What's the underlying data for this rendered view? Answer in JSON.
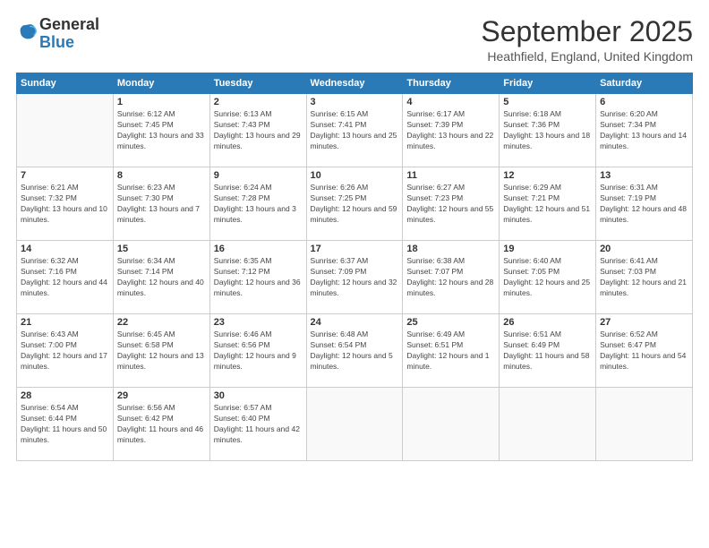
{
  "logo": {
    "text_general": "General",
    "text_blue": "Blue"
  },
  "title": "September 2025",
  "location": "Heathfield, England, United Kingdom",
  "days_of_week": [
    "Sunday",
    "Monday",
    "Tuesday",
    "Wednesday",
    "Thursday",
    "Friday",
    "Saturday"
  ],
  "weeks": [
    [
      {
        "day": "",
        "sunrise": "",
        "sunset": "",
        "daylight": ""
      },
      {
        "day": "1",
        "sunrise": "Sunrise: 6:12 AM",
        "sunset": "Sunset: 7:45 PM",
        "daylight": "Daylight: 13 hours and 33 minutes."
      },
      {
        "day": "2",
        "sunrise": "Sunrise: 6:13 AM",
        "sunset": "Sunset: 7:43 PM",
        "daylight": "Daylight: 13 hours and 29 minutes."
      },
      {
        "day": "3",
        "sunrise": "Sunrise: 6:15 AM",
        "sunset": "Sunset: 7:41 PM",
        "daylight": "Daylight: 13 hours and 25 minutes."
      },
      {
        "day": "4",
        "sunrise": "Sunrise: 6:17 AM",
        "sunset": "Sunset: 7:39 PM",
        "daylight": "Daylight: 13 hours and 22 minutes."
      },
      {
        "day": "5",
        "sunrise": "Sunrise: 6:18 AM",
        "sunset": "Sunset: 7:36 PM",
        "daylight": "Daylight: 13 hours and 18 minutes."
      },
      {
        "day": "6",
        "sunrise": "Sunrise: 6:20 AM",
        "sunset": "Sunset: 7:34 PM",
        "daylight": "Daylight: 13 hours and 14 minutes."
      }
    ],
    [
      {
        "day": "7",
        "sunrise": "Sunrise: 6:21 AM",
        "sunset": "Sunset: 7:32 PM",
        "daylight": "Daylight: 13 hours and 10 minutes."
      },
      {
        "day": "8",
        "sunrise": "Sunrise: 6:23 AM",
        "sunset": "Sunset: 7:30 PM",
        "daylight": "Daylight: 13 hours and 7 minutes."
      },
      {
        "day": "9",
        "sunrise": "Sunrise: 6:24 AM",
        "sunset": "Sunset: 7:28 PM",
        "daylight": "Daylight: 13 hours and 3 minutes."
      },
      {
        "day": "10",
        "sunrise": "Sunrise: 6:26 AM",
        "sunset": "Sunset: 7:25 PM",
        "daylight": "Daylight: 12 hours and 59 minutes."
      },
      {
        "day": "11",
        "sunrise": "Sunrise: 6:27 AM",
        "sunset": "Sunset: 7:23 PM",
        "daylight": "Daylight: 12 hours and 55 minutes."
      },
      {
        "day": "12",
        "sunrise": "Sunrise: 6:29 AM",
        "sunset": "Sunset: 7:21 PM",
        "daylight": "Daylight: 12 hours and 51 minutes."
      },
      {
        "day": "13",
        "sunrise": "Sunrise: 6:31 AM",
        "sunset": "Sunset: 7:19 PM",
        "daylight": "Daylight: 12 hours and 48 minutes."
      }
    ],
    [
      {
        "day": "14",
        "sunrise": "Sunrise: 6:32 AM",
        "sunset": "Sunset: 7:16 PM",
        "daylight": "Daylight: 12 hours and 44 minutes."
      },
      {
        "day": "15",
        "sunrise": "Sunrise: 6:34 AM",
        "sunset": "Sunset: 7:14 PM",
        "daylight": "Daylight: 12 hours and 40 minutes."
      },
      {
        "day": "16",
        "sunrise": "Sunrise: 6:35 AM",
        "sunset": "Sunset: 7:12 PM",
        "daylight": "Daylight: 12 hours and 36 minutes."
      },
      {
        "day": "17",
        "sunrise": "Sunrise: 6:37 AM",
        "sunset": "Sunset: 7:09 PM",
        "daylight": "Daylight: 12 hours and 32 minutes."
      },
      {
        "day": "18",
        "sunrise": "Sunrise: 6:38 AM",
        "sunset": "Sunset: 7:07 PM",
        "daylight": "Daylight: 12 hours and 28 minutes."
      },
      {
        "day": "19",
        "sunrise": "Sunrise: 6:40 AM",
        "sunset": "Sunset: 7:05 PM",
        "daylight": "Daylight: 12 hours and 25 minutes."
      },
      {
        "day": "20",
        "sunrise": "Sunrise: 6:41 AM",
        "sunset": "Sunset: 7:03 PM",
        "daylight": "Daylight: 12 hours and 21 minutes."
      }
    ],
    [
      {
        "day": "21",
        "sunrise": "Sunrise: 6:43 AM",
        "sunset": "Sunset: 7:00 PM",
        "daylight": "Daylight: 12 hours and 17 minutes."
      },
      {
        "day": "22",
        "sunrise": "Sunrise: 6:45 AM",
        "sunset": "Sunset: 6:58 PM",
        "daylight": "Daylight: 12 hours and 13 minutes."
      },
      {
        "day": "23",
        "sunrise": "Sunrise: 6:46 AM",
        "sunset": "Sunset: 6:56 PM",
        "daylight": "Daylight: 12 hours and 9 minutes."
      },
      {
        "day": "24",
        "sunrise": "Sunrise: 6:48 AM",
        "sunset": "Sunset: 6:54 PM",
        "daylight": "Daylight: 12 hours and 5 minutes."
      },
      {
        "day": "25",
        "sunrise": "Sunrise: 6:49 AM",
        "sunset": "Sunset: 6:51 PM",
        "daylight": "Daylight: 12 hours and 1 minute."
      },
      {
        "day": "26",
        "sunrise": "Sunrise: 6:51 AM",
        "sunset": "Sunset: 6:49 PM",
        "daylight": "Daylight: 11 hours and 58 minutes."
      },
      {
        "day": "27",
        "sunrise": "Sunrise: 6:52 AM",
        "sunset": "Sunset: 6:47 PM",
        "daylight": "Daylight: 11 hours and 54 minutes."
      }
    ],
    [
      {
        "day": "28",
        "sunrise": "Sunrise: 6:54 AM",
        "sunset": "Sunset: 6:44 PM",
        "daylight": "Daylight: 11 hours and 50 minutes."
      },
      {
        "day": "29",
        "sunrise": "Sunrise: 6:56 AM",
        "sunset": "Sunset: 6:42 PM",
        "daylight": "Daylight: 11 hours and 46 minutes."
      },
      {
        "day": "30",
        "sunrise": "Sunrise: 6:57 AM",
        "sunset": "Sunset: 6:40 PM",
        "daylight": "Daylight: 11 hours and 42 minutes."
      },
      {
        "day": "",
        "sunrise": "",
        "sunset": "",
        "daylight": ""
      },
      {
        "day": "",
        "sunrise": "",
        "sunset": "",
        "daylight": ""
      },
      {
        "day": "",
        "sunrise": "",
        "sunset": "",
        "daylight": ""
      },
      {
        "day": "",
        "sunrise": "",
        "sunset": "",
        "daylight": ""
      }
    ]
  ]
}
